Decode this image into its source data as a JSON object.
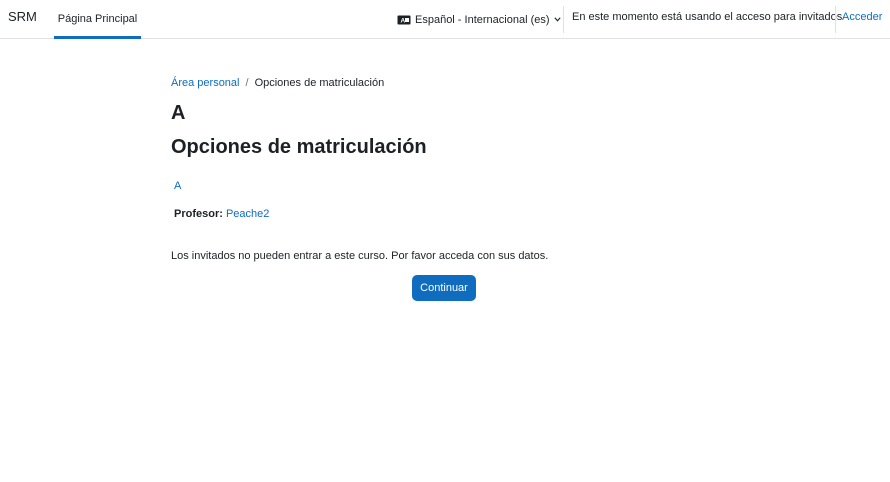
{
  "navbar": {
    "brand": "SRM",
    "home_label": "Página Principal",
    "language": "Español - Internacional (es)",
    "language_icon": "language-icon",
    "guest_message": "En este momento está usando el acceso para invitados",
    "login_label": "Acceder"
  },
  "breadcrumb": {
    "items": [
      "Área personal",
      "Opciones de matriculación"
    ],
    "separator": "/"
  },
  "course": {
    "title": "A",
    "link": "A",
    "teacher_label": "Profesor:",
    "teacher_name": "Peache2"
  },
  "page": {
    "heading": "Opciones de matriculación",
    "notice": "Los invitados no pueden entrar a este curso. Por favor acceda con sus datos.",
    "continue_label": "Continuar"
  },
  "colors": {
    "accent": "#0f6cbf",
    "text": "#1d2125",
    "border": "#dee2e6"
  }
}
